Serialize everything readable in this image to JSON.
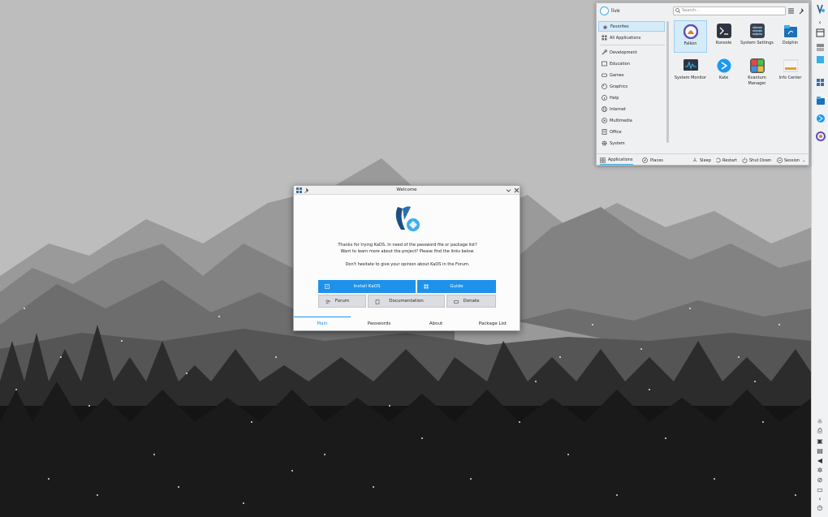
{
  "launcher": {
    "user": "live",
    "search_placeholder": "Search...",
    "categories": [
      {
        "label": "Favorites",
        "icon": "star-icon"
      },
      {
        "label": "All Applications",
        "icon": "grid-icon"
      },
      {
        "label": "Development",
        "icon": "wrench-icon"
      },
      {
        "label": "Education",
        "icon": "education-icon"
      },
      {
        "label": "Games",
        "icon": "gamepad-icon"
      },
      {
        "label": "Graphics",
        "icon": "graphics-icon"
      },
      {
        "label": "Help",
        "icon": "help-icon"
      },
      {
        "label": "Internet",
        "icon": "globe-icon"
      },
      {
        "label": "Multimedia",
        "icon": "multimedia-icon"
      },
      {
        "label": "Office",
        "icon": "office-icon"
      },
      {
        "label": "System",
        "icon": "gear-icon"
      }
    ],
    "apps": [
      {
        "label": "Falkon",
        "icon": "falkon-icon",
        "color": "#5b4ec0"
      },
      {
        "label": "Konsole",
        "icon": "konsole-icon",
        "color": "#2e3440"
      },
      {
        "label": "System Settings",
        "icon": "settings-icon",
        "color": "#3b4252"
      },
      {
        "label": "Dolphin",
        "icon": "dolphin-icon",
        "color": "#3daee9"
      },
      {
        "label": "System Monitor",
        "icon": "monitor-icon",
        "color": "#2e3440"
      },
      {
        "label": "Kate",
        "icon": "kate-icon",
        "color": "#1d99f3"
      },
      {
        "label": "Kvantum Manager",
        "icon": "kvantum-icon",
        "color": "#555555"
      },
      {
        "label": "Info Center",
        "icon": "info-icon",
        "color": "#e0a030"
      }
    ],
    "footer": {
      "applications": "Applications",
      "places": "Places",
      "sleep": "Sleep",
      "restart": "Restart",
      "shutdown": "Shut Down",
      "session": "Session"
    }
  },
  "welcome": {
    "title": "Welcome",
    "intro_line1": "Thanks for trying KaOS. In need of the password file or package list?",
    "intro_line2": "Want to learn more about the project? Please find the links below.",
    "intro_line3": "Don't hesitate to give your opinion about KaOS in the Forum.",
    "buttons": {
      "install": "Install KaOS",
      "guide": "Guide",
      "forum": "Forum",
      "documentation": "Documentation",
      "donate": "Donate"
    },
    "tabs": [
      "Main",
      "Passwords",
      "About",
      "Package List"
    ]
  },
  "colors": {
    "accent": "#1e92ea",
    "selection": "#d6ebf8"
  }
}
